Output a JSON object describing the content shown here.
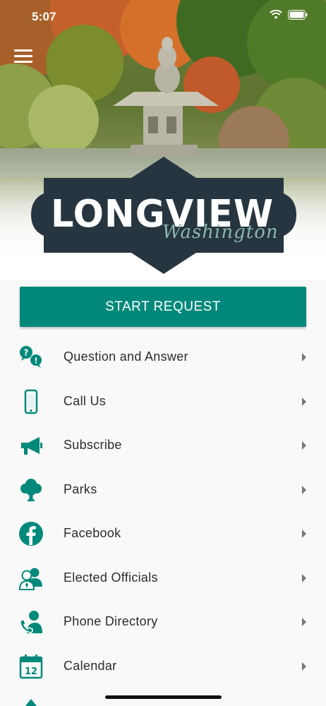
{
  "status_bar": {
    "time": "5:07"
  },
  "logo": {
    "title": "LONGVIEW",
    "script": "Washington"
  },
  "start_request": {
    "label": "START REQUEST"
  },
  "menu": [
    {
      "label": "Question and Answer",
      "icon": "question-answer-icon"
    },
    {
      "label": "Call Us",
      "icon": "phone-icon"
    },
    {
      "label": "Subscribe",
      "icon": "megaphone-icon"
    },
    {
      "label": "Parks",
      "icon": "tree-icon"
    },
    {
      "label": "Facebook",
      "icon": "facebook-icon"
    },
    {
      "label": "Elected Officials",
      "icon": "officials-icon"
    },
    {
      "label": "Phone Directory",
      "icon": "phone-directory-icon"
    },
    {
      "label": "Calendar",
      "icon": "calendar-icon"
    }
  ],
  "colors": {
    "accent": "#00897b",
    "logo_bg": "#263540",
    "text": "#2d2d2d"
  }
}
